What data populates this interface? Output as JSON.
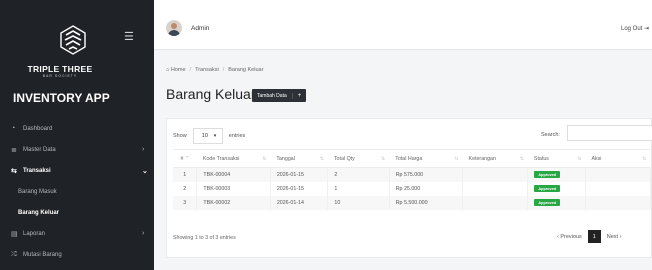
{
  "sidebar": {
    "brand_name": "TRIPLE THREE",
    "brand_subtitle": "BAR SOCIETY",
    "app_title": "INVENTORY APP",
    "items": [
      {
        "label": "Dashboard",
        "icon": "dashboard-icon"
      },
      {
        "label": "Master Data",
        "icon": "database-icon"
      },
      {
        "label": "Transaksi",
        "icon": "exchange-icon"
      },
      {
        "label": "Barang Masuk"
      },
      {
        "label": "Barang Keluar"
      },
      {
        "label": "Laporan",
        "icon": "report-icon"
      },
      {
        "label": "Mutasi Barang",
        "icon": "shuffle-icon"
      }
    ]
  },
  "topbar": {
    "user_name": "Admin",
    "logout_label": "Log Out"
  },
  "breadcrumb": [
    "Home",
    "Transaksi",
    "Barang Keluar"
  ],
  "page": {
    "title": "Barang Keluar",
    "add_button": "Tambah Data",
    "add_plus": "+"
  },
  "table_controls": {
    "show_label": "Show",
    "entries_value": "10",
    "entries_label": "entries",
    "search_label": "Search:"
  },
  "table": {
    "headers": [
      "#",
      "Kode Transaksi",
      "Tanggal",
      "Total Qty",
      "Total Harga",
      "Keterangan",
      "Status",
      "Aksi"
    ],
    "rows": [
      {
        "no": "1",
        "kode": "TBK-00004",
        "tanggal": "2026-01-15",
        "qty": "2",
        "harga": "Rp 575.000",
        "keterangan": "",
        "status": "Approved"
      },
      {
        "no": "2",
        "kode": "TBK-00003",
        "tanggal": "2026-01-15",
        "qty": "1",
        "harga": "Rp 25.000",
        "keterangan": "",
        "status": "Approved"
      },
      {
        "no": "3",
        "kode": "TBK-00002",
        "tanggal": "2026-01-14",
        "qty": "10",
        "harga": "Rp 5.500.000",
        "keterangan": "",
        "status": "Approved"
      }
    ]
  },
  "footer": {
    "info": "Showing 1 to 3 of 3 entries",
    "prev": "‹ Previous",
    "page": "1",
    "next": "Next ›"
  },
  "colors": {
    "sidebar_bg": "#1f2226",
    "accent_dark": "#222222",
    "status_approved": "#28a745"
  }
}
